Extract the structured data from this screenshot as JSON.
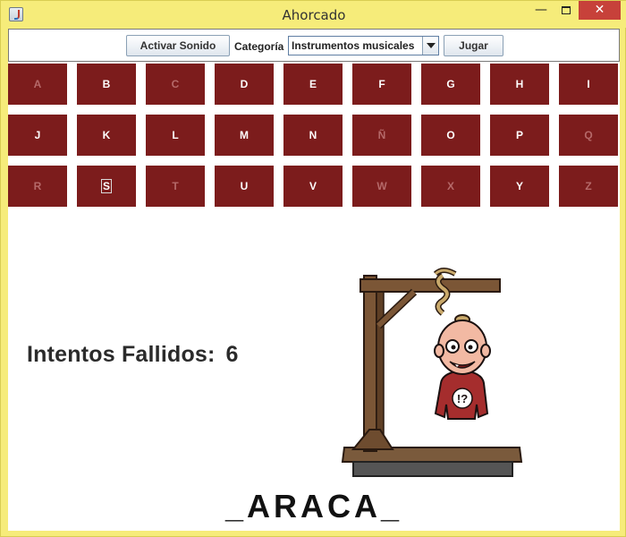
{
  "window": {
    "title": "Ahorcado",
    "minimize": "—",
    "close": "✕"
  },
  "toolbar": {
    "sound_button": "Activar Sonido",
    "category_label": "Categoría",
    "category_value": "Instrumentos musicales",
    "play_button": "Jugar"
  },
  "keyboard": {
    "letters": [
      {
        "letter": "A",
        "state": "used"
      },
      {
        "letter": "B",
        "state": "available"
      },
      {
        "letter": "C",
        "state": "used"
      },
      {
        "letter": "D",
        "state": "available"
      },
      {
        "letter": "E",
        "state": "available"
      },
      {
        "letter": "F",
        "state": "available"
      },
      {
        "letter": "G",
        "state": "available"
      },
      {
        "letter": "H",
        "state": "available"
      },
      {
        "letter": "I",
        "state": "available"
      },
      {
        "letter": "J",
        "state": "available"
      },
      {
        "letter": "K",
        "state": "available"
      },
      {
        "letter": "L",
        "state": "available"
      },
      {
        "letter": "M",
        "state": "available"
      },
      {
        "letter": "N",
        "state": "available"
      },
      {
        "letter": "Ñ",
        "state": "used"
      },
      {
        "letter": "O",
        "state": "available"
      },
      {
        "letter": "P",
        "state": "available"
      },
      {
        "letter": "Q",
        "state": "used"
      },
      {
        "letter": "R",
        "state": "used"
      },
      {
        "letter": "S",
        "state": "focused"
      },
      {
        "letter": "T",
        "state": "used"
      },
      {
        "letter": "U",
        "state": "available"
      },
      {
        "letter": "V",
        "state": "available"
      },
      {
        "letter": "W",
        "state": "used"
      },
      {
        "letter": "X",
        "state": "used"
      },
      {
        "letter": "Y",
        "state": "available"
      },
      {
        "letter": "Z",
        "state": "used"
      }
    ]
  },
  "game": {
    "fails_label": "Intentos Fallidos:",
    "fails_count": "6",
    "word": "_ARACA_",
    "shirt_text": "!?"
  },
  "colors": {
    "key_bg": "#7c1c1c",
    "window_frame": "#f6ec7a",
    "close_button": "#c7413a"
  }
}
